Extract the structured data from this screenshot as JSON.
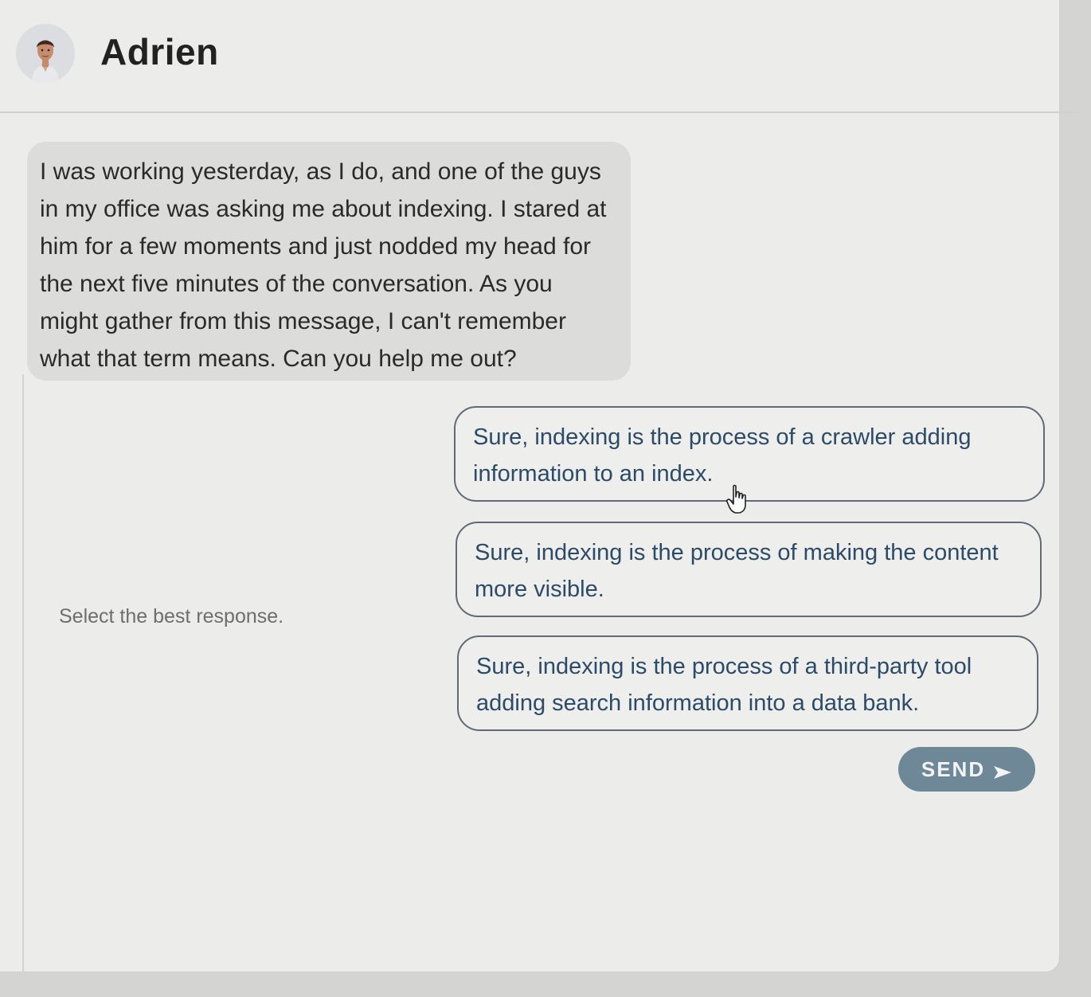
{
  "header": {
    "contact_name": "Adrien",
    "avatar_icon": "person-avatar-icon"
  },
  "message": {
    "text": "I was working yesterday, as I do, and one of the guys in my office was asking me about indexing. I stared at him for a few moments and just nodded my head for the next five minutes of the conversation. As you might gather from this message, I can't remember what that term means. Can you help me out?"
  },
  "prompt": {
    "label": "Select the best response."
  },
  "options": [
    {
      "text": "Sure, indexing is the process of a crawler adding information to an index."
    },
    {
      "text": "Sure, indexing is the process of making the content more visible."
    },
    {
      "text": "Sure, indexing is the process of a third-party tool adding search information into a data bank."
    }
  ],
  "send": {
    "label": "SEND",
    "icon": "send-arrow-icon"
  },
  "colors": {
    "option_border": "#5f6b77",
    "option_text": "#2c4b68",
    "send_button_bg": "#6f8898",
    "bubble_bg": "#dcdcda"
  }
}
